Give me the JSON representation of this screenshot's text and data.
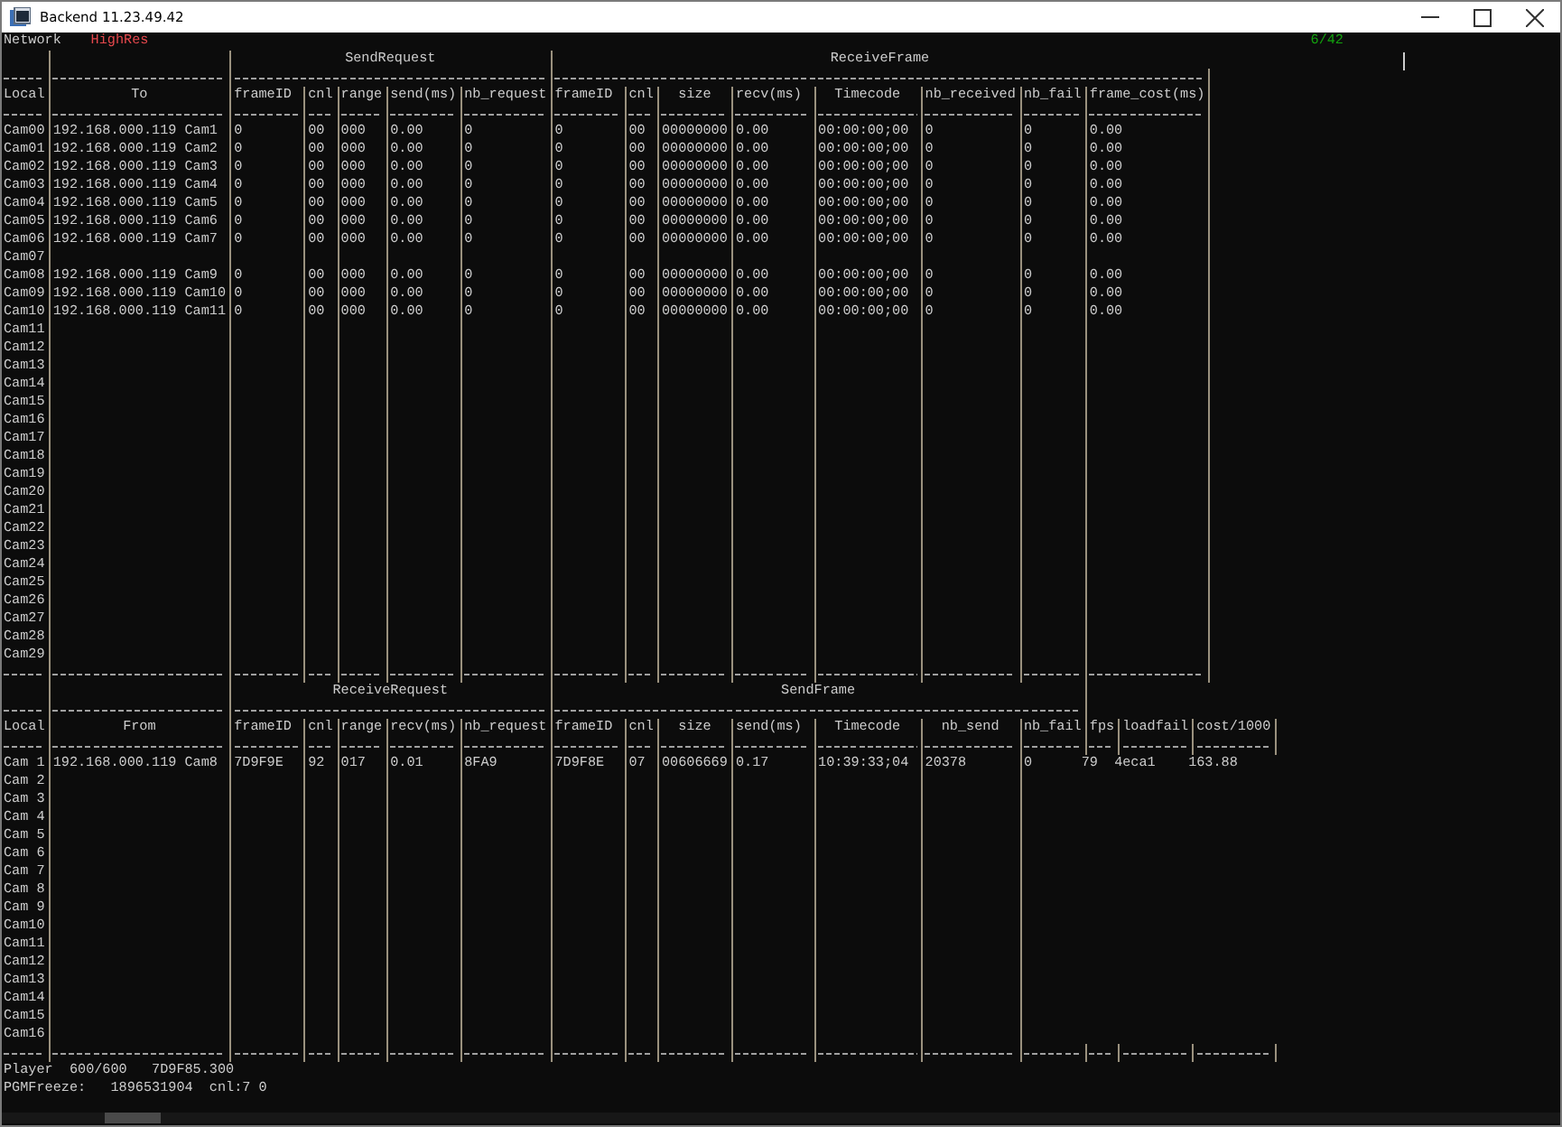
{
  "window": {
    "title": "Backend 11.23.49.42"
  },
  "status_line": {
    "label": "Network",
    "mode": "HighRes",
    "counter": "6/42"
  },
  "tables": [
    {
      "groups": [
        "SendRequest",
        "ReceiveFrame"
      ],
      "columns": [
        "Local",
        "To",
        "frameID",
        "cnl",
        "range",
        "send(ms)",
        "nb_request",
        "frameID",
        "cnl",
        "size",
        "recv(ms)",
        "Timecode",
        "nb_received",
        "nb_fail",
        "frame_cost(ms)"
      ],
      "rows": [
        [
          "Cam00",
          "192.168.000.119 Cam1",
          "0",
          "00",
          "000",
          "0.00",
          "0",
          "0",
          "00",
          "00000000",
          "0.00",
          "00:00:00;00",
          "0",
          "0",
          "0.00"
        ],
        [
          "Cam01",
          "192.168.000.119 Cam2",
          "0",
          "00",
          "000",
          "0.00",
          "0",
          "0",
          "00",
          "00000000",
          "0.00",
          "00:00:00;00",
          "0",
          "0",
          "0.00"
        ],
        [
          "Cam02",
          "192.168.000.119 Cam3",
          "0",
          "00",
          "000",
          "0.00",
          "0",
          "0",
          "00",
          "00000000",
          "0.00",
          "00:00:00;00",
          "0",
          "0",
          "0.00"
        ],
        [
          "Cam03",
          "192.168.000.119 Cam4",
          "0",
          "00",
          "000",
          "0.00",
          "0",
          "0",
          "00",
          "00000000",
          "0.00",
          "00:00:00;00",
          "0",
          "0",
          "0.00"
        ],
        [
          "Cam04",
          "192.168.000.119 Cam5",
          "0",
          "00",
          "000",
          "0.00",
          "0",
          "0",
          "00",
          "00000000",
          "0.00",
          "00:00:00;00",
          "0",
          "0",
          "0.00"
        ],
        [
          "Cam05",
          "192.168.000.119 Cam6",
          "0",
          "00",
          "000",
          "0.00",
          "0",
          "0",
          "00",
          "00000000",
          "0.00",
          "00:00:00;00",
          "0",
          "0",
          "0.00"
        ],
        [
          "Cam06",
          "192.168.000.119 Cam7",
          "0",
          "00",
          "000",
          "0.00",
          "0",
          "0",
          "00",
          "00000000",
          "0.00",
          "00:00:00;00",
          "0",
          "0",
          "0.00"
        ],
        [
          "Cam07"
        ],
        [
          "Cam08",
          "192.168.000.119 Cam9",
          "0",
          "00",
          "000",
          "0.00",
          "0",
          "0",
          "00",
          "00000000",
          "0.00",
          "00:00:00;00",
          "0",
          "0",
          "0.00"
        ],
        [
          "Cam09",
          "192.168.000.119 Cam10",
          "0",
          "00",
          "000",
          "0.00",
          "0",
          "0",
          "00",
          "00000000",
          "0.00",
          "00:00:00;00",
          "0",
          "0",
          "0.00"
        ],
        [
          "Cam10",
          "192.168.000.119 Cam11",
          "0",
          "00",
          "000",
          "0.00",
          "0",
          "0",
          "00",
          "00000000",
          "0.00",
          "00:00:00;00",
          "0",
          "0",
          "0.00"
        ],
        [
          "Cam11"
        ],
        [
          "Cam12"
        ],
        [
          "Cam13"
        ],
        [
          "Cam14"
        ],
        [
          "Cam15"
        ],
        [
          "Cam16"
        ],
        [
          "Cam17"
        ],
        [
          "Cam18"
        ],
        [
          "Cam19"
        ],
        [
          "Cam20"
        ],
        [
          "Cam21"
        ],
        [
          "Cam22"
        ],
        [
          "Cam23"
        ],
        [
          "Cam24"
        ],
        [
          "Cam25"
        ],
        [
          "Cam26"
        ],
        [
          "Cam27"
        ],
        [
          "Cam28"
        ],
        [
          "Cam29"
        ]
      ]
    },
    {
      "groups": [
        "ReceiveRequest",
        "SendFrame"
      ],
      "columns": [
        "Local",
        "From",
        "frameID",
        "cnl",
        "range",
        "recv(ms)",
        "nb_request",
        "frameID",
        "cnl",
        "size",
        "send(ms)",
        "Timecode",
        "nb_send",
        "nb_fail",
        "fps",
        "loadfail",
        "cost/1000"
      ],
      "rows": [
        [
          "Cam 1",
          "192.168.000.119 Cam8",
          "7D9F9E",
          "92",
          "017",
          "0.01",
          "8FA9",
          "7D9F8E",
          "07",
          "00606669",
          "0.17",
          "10:39:33;04",
          "20378",
          "0",
          "79",
          "4eca1",
          "163.88"
        ],
        [
          "Cam 2"
        ],
        [
          "Cam 3"
        ],
        [
          "Cam 4"
        ],
        [
          "Cam 5"
        ],
        [
          "Cam 6"
        ],
        [
          "Cam 7"
        ],
        [
          "Cam 8"
        ],
        [
          "Cam 9"
        ],
        [
          "Cam10"
        ],
        [
          "Cam11"
        ],
        [
          "Cam12"
        ],
        [
          "Cam13"
        ],
        [
          "Cam14"
        ],
        [
          "Cam15"
        ],
        [
          "Cam16"
        ]
      ]
    }
  ],
  "footer": [
    "Player  600/600   7D9F85.300",
    "PGMFreeze:   1896531904  cnl:7 0"
  ]
}
